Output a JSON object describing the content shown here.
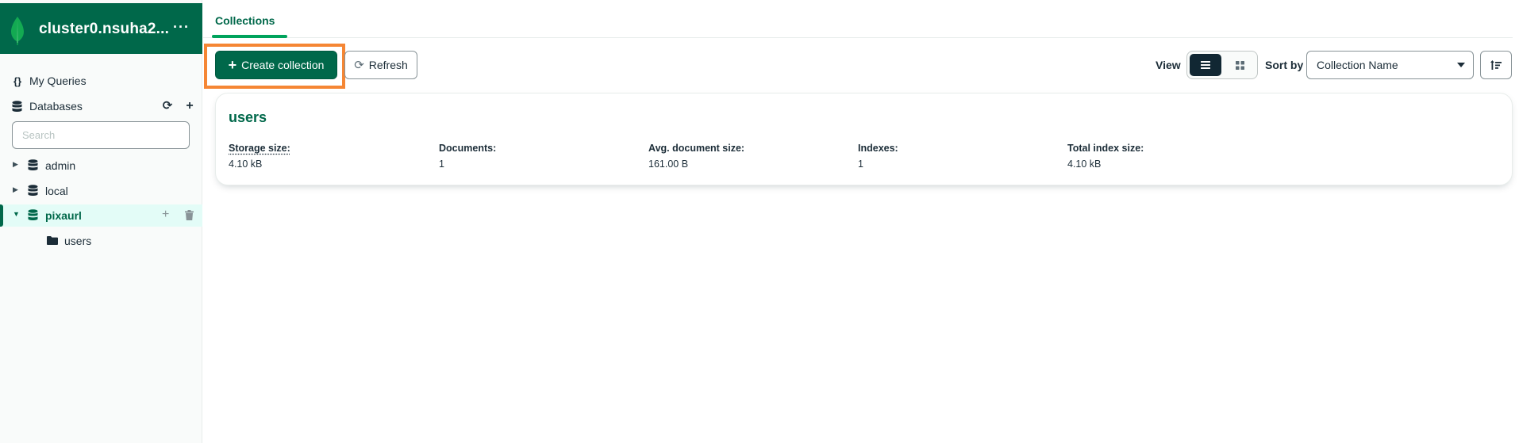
{
  "sidebar": {
    "cluster_name": "cluster0.nsuha2...",
    "cluster_menu": "···",
    "my_queries": {
      "icon": "{}",
      "label": "My Queries"
    },
    "databases": {
      "label": "Databases"
    },
    "search_placeholder": "Search",
    "db_list": [
      {
        "name": "admin",
        "expanded": false
      },
      {
        "name": "local",
        "expanded": false
      },
      {
        "name": "pixaurl",
        "expanded": true,
        "active": true
      }
    ],
    "collections": [
      {
        "name": "users"
      }
    ]
  },
  "tabs": [
    {
      "label": "Collections",
      "active": true
    }
  ],
  "toolbar": {
    "create_label": "Create collection",
    "refresh_label": "Refresh",
    "view_label": "View",
    "view_mode": "list",
    "sort_label": "Sort by",
    "sort_value": "Collection Name"
  },
  "collection_cards": [
    {
      "name": "users",
      "stats": [
        {
          "label": "Storage size:",
          "value": "4.10 kB"
        },
        {
          "label": "Documents:",
          "value": "1"
        },
        {
          "label": "Avg. document size:",
          "value": "161.00 B"
        },
        {
          "label": "Indexes:",
          "value": "1"
        },
        {
          "label": "Total index size:",
          "value": "4.10 kB"
        }
      ]
    }
  ],
  "colors": {
    "brand_green": "#00684a",
    "accent_green": "#00a35c",
    "highlight_orange": "#f58634",
    "dark": "#1c2d38"
  }
}
